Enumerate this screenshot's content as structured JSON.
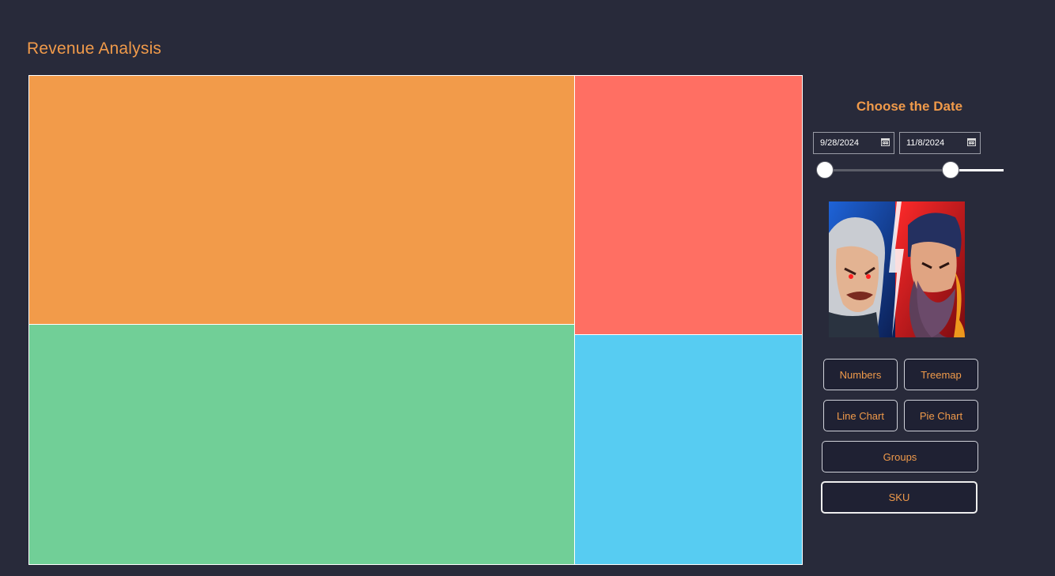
{
  "header": {
    "title": "Revenue Analysis"
  },
  "treemap": {
    "tiles": [
      {
        "name": "tile-orange",
        "color": "#f29b4a"
      },
      {
        "name": "tile-green",
        "color": "#71cf97"
      },
      {
        "name": "tile-red",
        "color": "#ff6f63"
      },
      {
        "name": "tile-blue",
        "color": "#57ccf2"
      }
    ]
  },
  "date_filter": {
    "heading": "Choose the Date",
    "start_date": "9/28/2024",
    "end_date": "11/8/2024"
  },
  "game_art": {
    "name": "game-key-art"
  },
  "nav": {
    "numbers": "Numbers",
    "treemap": "Treemap",
    "line_chart": "Line Chart",
    "pie_chart": "Pie Chart",
    "groups": "Groups",
    "sku": "SKU",
    "selected": "SKU"
  },
  "colors": {
    "background": "#282a3a",
    "accent": "#f09a4a",
    "button_bg": "#1f2133"
  }
}
